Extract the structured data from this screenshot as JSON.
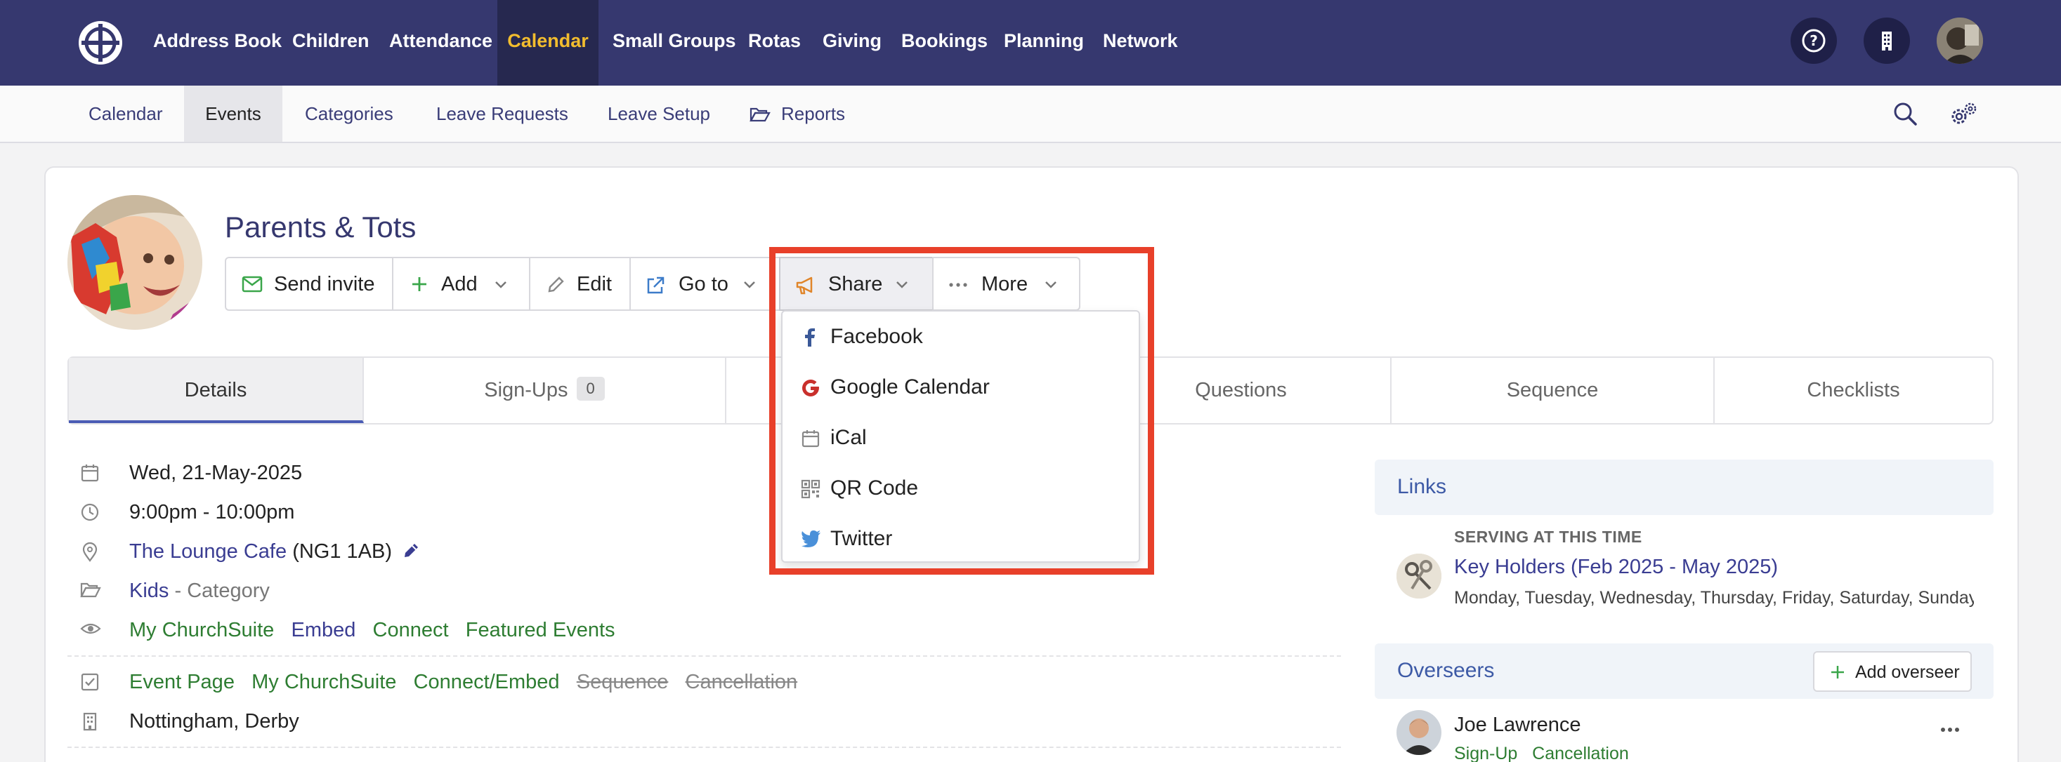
{
  "topnav": {
    "items": [
      "Address Book",
      "Children",
      "Attendance",
      "Calendar",
      "Small Groups",
      "Rotas",
      "Giving",
      "Bookings",
      "Planning",
      "Network"
    ],
    "active": "Calendar",
    "help_icon": "help-circle-icon",
    "org_icon": "building-icon"
  },
  "subnav": {
    "items": [
      "Calendar",
      "Events",
      "Categories",
      "Leave Requests",
      "Leave Setup",
      "Reports"
    ],
    "active": "Events"
  },
  "event": {
    "title": "Parents & Tots"
  },
  "toolbar": {
    "send_invite": "Send invite",
    "add": "Add",
    "edit": "Edit",
    "go_to": "Go to",
    "share": "Share",
    "more": "More"
  },
  "share_menu": {
    "items": [
      "Facebook",
      "Google Calendar",
      "iCal",
      "QR Code",
      "Twitter"
    ]
  },
  "tabs": {
    "details": "Details",
    "signups": "Sign-Ups",
    "signups_count": "0",
    "questions": "Questions",
    "sequence": "Sequence",
    "checklists": "Checklists"
  },
  "details": {
    "date": "Wed, 21-May-2025",
    "time": "9:00pm - 10:00pm",
    "location_name": "The Lounge Cafe",
    "location_postcode": "(NG1 1AB)",
    "category": "Kids",
    "category_suffix": "- Category",
    "visibility": [
      "My ChurchSuite",
      "Embed",
      "Connect",
      "Featured Events"
    ],
    "flags_active": [
      "Event Page",
      "My ChurchSuite",
      "Connect/Embed"
    ],
    "flags_inactive": [
      "Sequence",
      "Cancellation"
    ],
    "sites": "Nottingham, Derby"
  },
  "links_panel": {
    "title": "Links",
    "label": "SERVING AT THIS TIME",
    "rota": "Key Holders (Feb 2025 - May 2025)",
    "days": "Monday, Tuesday, Wednesday, Thursday, Friday, Saturday, Sunday"
  },
  "overseers_panel": {
    "title": "Overseers",
    "add_button": "Add overseer",
    "person_name": "Joe Lawrence",
    "person_tags": [
      "Sign-Up",
      "Cancellation"
    ]
  },
  "colors": {
    "nav_bg": "#36386f",
    "nav_active_text": "#f2bd2e",
    "link_blue": "#3a3d92",
    "link_green": "#2e7d32",
    "highlight": "#e8402a"
  }
}
